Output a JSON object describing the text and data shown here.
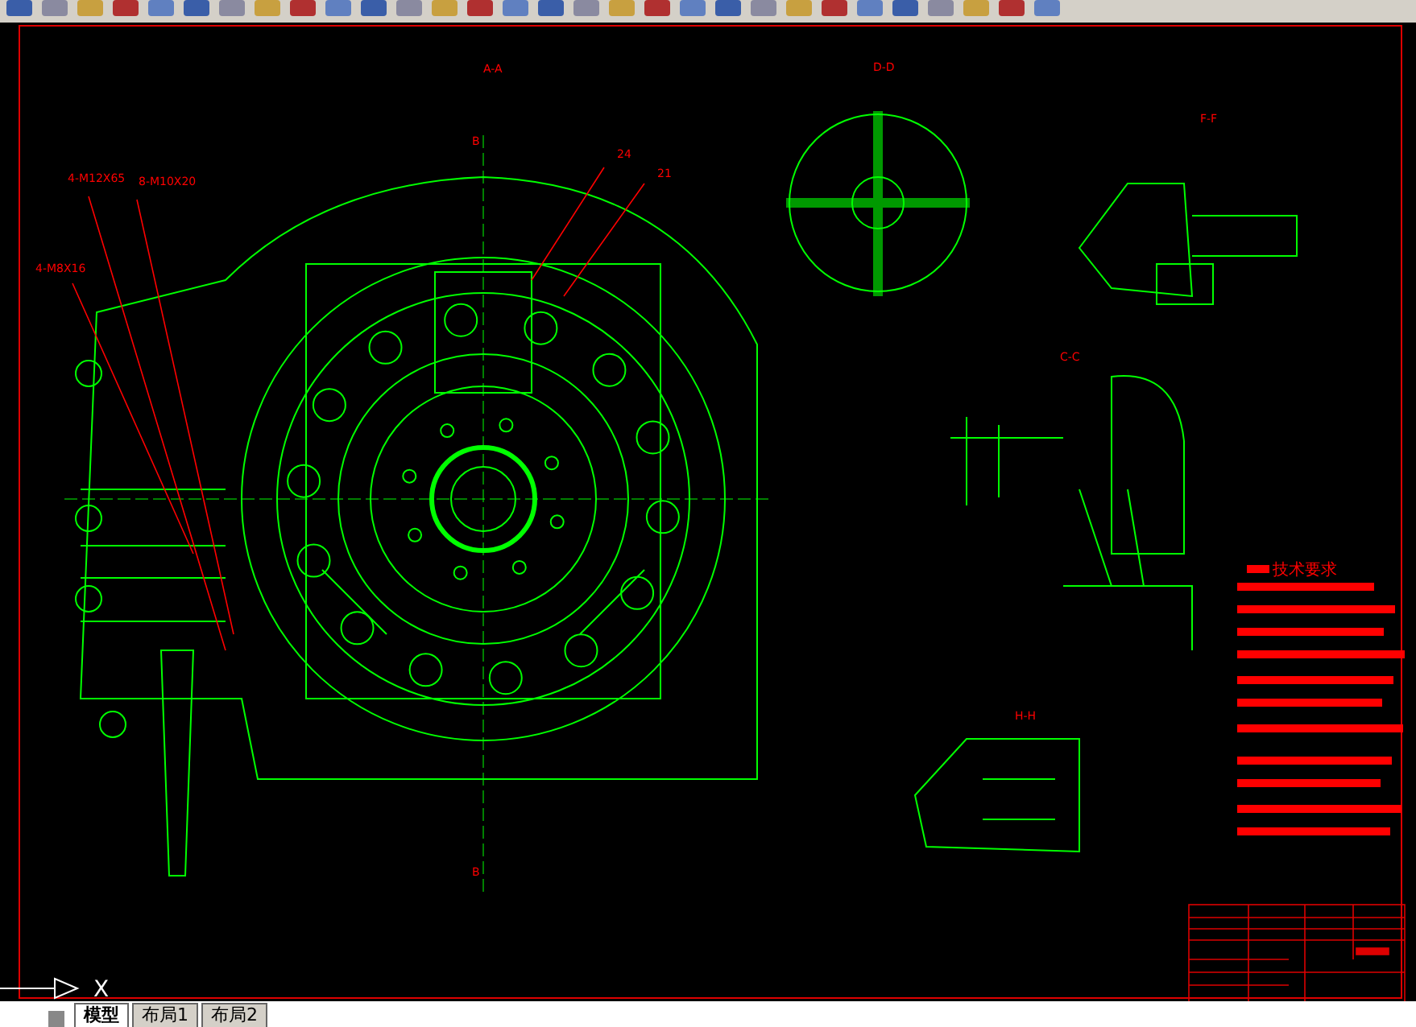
{
  "drawing": {
    "labels": [
      {
        "text": "A-A"
      },
      {
        "text": "B"
      },
      {
        "text": "B"
      },
      {
        "text": "D-D"
      },
      {
        "text": "F-F"
      },
      {
        "text": "C-C"
      },
      {
        "text": "H-H"
      },
      {
        "text": "4-M12X65"
      },
      {
        "text": "8-M10X20"
      },
      {
        "text": "4-M8X16"
      },
      {
        "text": "24"
      },
      {
        "text": "21"
      }
    ],
    "requirements_title": "技术要求"
  },
  "ucs": {
    "axis": "X"
  },
  "tabs": [
    {
      "label": "模型",
      "selected": true
    },
    {
      "label": "布局1",
      "selected": false
    },
    {
      "label": "布局2",
      "selected": false
    }
  ]
}
